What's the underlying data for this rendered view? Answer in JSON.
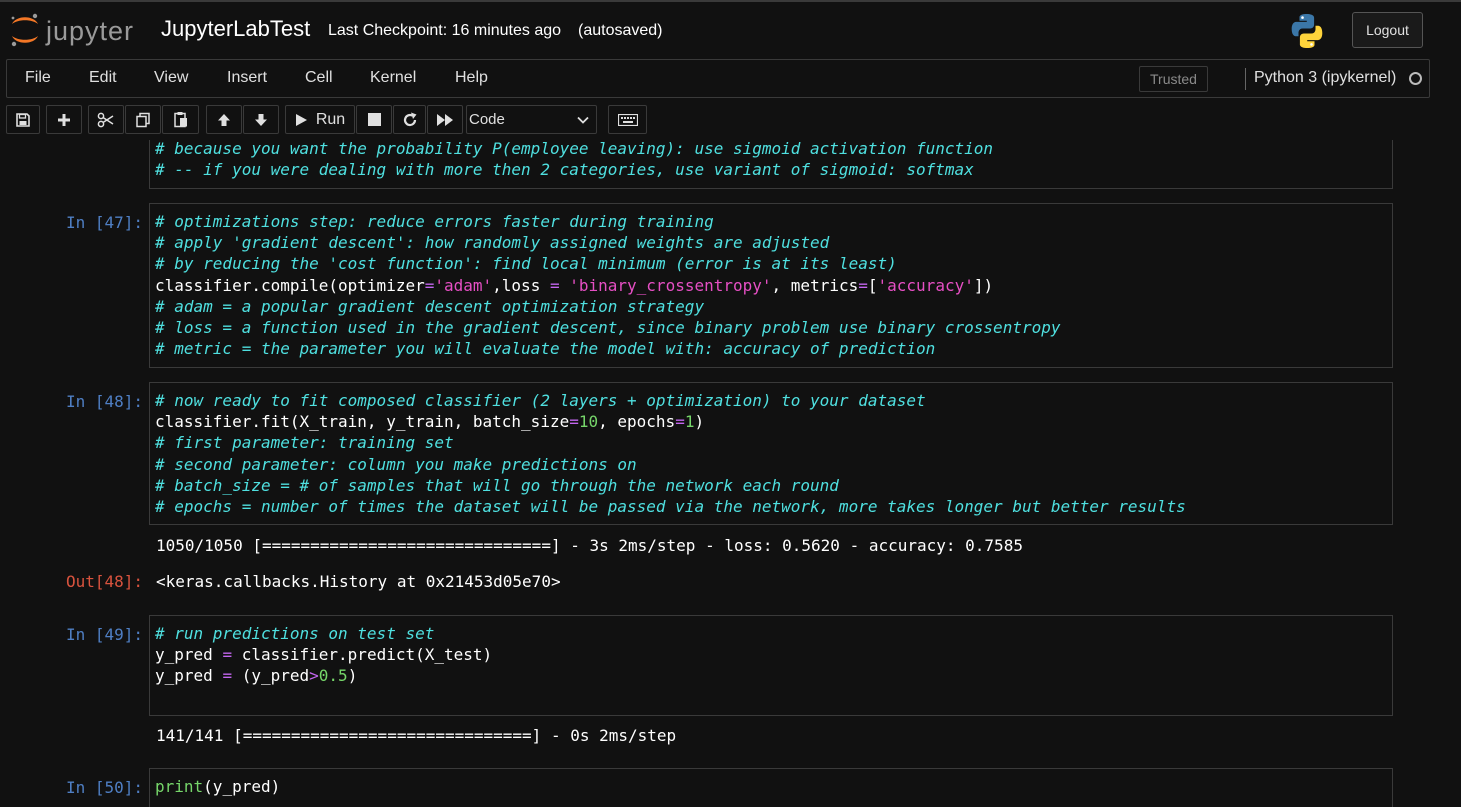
{
  "header": {
    "logo_text": "jupyter",
    "notebook_name": "JupyterLabTest",
    "checkpoint": "Last Checkpoint: 16 minutes ago",
    "autosave": "(autosaved)",
    "logout_label": "Logout"
  },
  "menubar": {
    "items": [
      "File",
      "Edit",
      "View",
      "Insert",
      "Cell",
      "Kernel",
      "Help"
    ],
    "trusted_label": "Trusted",
    "kernel_name": "Python 3 (ipykernel)"
  },
  "toolbar": {
    "run_label": "Run",
    "cell_type": "Code"
  },
  "cells": {
    "c46": {
      "lines": [
        "# because you want the probability P(employee leaving): use sigmoid activation function",
        "# -- if you were dealing with more then 2 categories, use variant of sigmoid: softmax"
      ]
    },
    "c47": {
      "prompt": "In [47]:",
      "comment_lines": [
        "# optimizations step: reduce errors faster during training",
        "# apply 'gradient descent': how randomly assigned weights are adjusted",
        "# by reducing the 'cost function': find local minimum (error is at its least)"
      ],
      "code_line": {
        "a": "classifier.compile(optimizer",
        "eq1": "=",
        "s1": "'adam'",
        "b": ",loss ",
        "eq2": "=",
        "c": " ",
        "s2": "'binary_crossentropy'",
        "d": ", metrics",
        "eq3": "=",
        "e": "[",
        "s3": "'accuracy'",
        "f": "])"
      },
      "comment_lines_after": [
        "# adam = a popular gradient descent optimization strategy",
        "# loss = a function used in the gradient descent, since binary problem use binary crossentropy",
        "# metric = the parameter you will evaluate the model with: accuracy of prediction"
      ]
    },
    "c48": {
      "prompt": "In [48]:",
      "comment_first": "# now ready to fit composed classifier (2 layers + optimization) to your dataset",
      "code_line": {
        "a": "classifier.fit(X_train, y_train, batch_size",
        "eq1": "=",
        "n1": "10",
        "b": ", epochs",
        "eq2": "=",
        "n2": "1",
        "c": ")"
      },
      "comment_lines_after": [
        "# first parameter: training set",
        "# second parameter: column you make predictions on",
        "# batch_size = # of samples that will go through the network each round",
        "# epochs = number of times the dataset will be passed via the network, more takes longer but better results"
      ],
      "stream_output": "1050/1050 [==============================] - 3s 2ms/step - loss: 0.5620 - accuracy: 0.7585",
      "out_prompt": "Out[48]:",
      "out_value": "<keras.callbacks.History at 0x21453d05e70>"
    },
    "c49": {
      "prompt": "In [49]:",
      "comment": "# run predictions on test set",
      "line2": {
        "a": "y_pred ",
        "eq": "=",
        "b": " classifier.predict(X_test)"
      },
      "line3": {
        "a": "y_pred ",
        "eq": "=",
        "b": " (y_pred",
        "gt": ">",
        "n": "0.5",
        "c": ")"
      },
      "stream_output": "141/141 [==============================] - 0s 2ms/step"
    },
    "c50": {
      "prompt": "In [50]:",
      "fn": "print",
      "rest": "(y_pred)"
    }
  },
  "colors": {
    "background": "#111111",
    "border": "#3a3a3a",
    "comment": "#4fe0e0",
    "string": "#e64fc4",
    "number": "#76d66a",
    "operator": "#c466f0",
    "in_prompt": "#4f7fc4",
    "out_prompt": "#d9533e"
  }
}
